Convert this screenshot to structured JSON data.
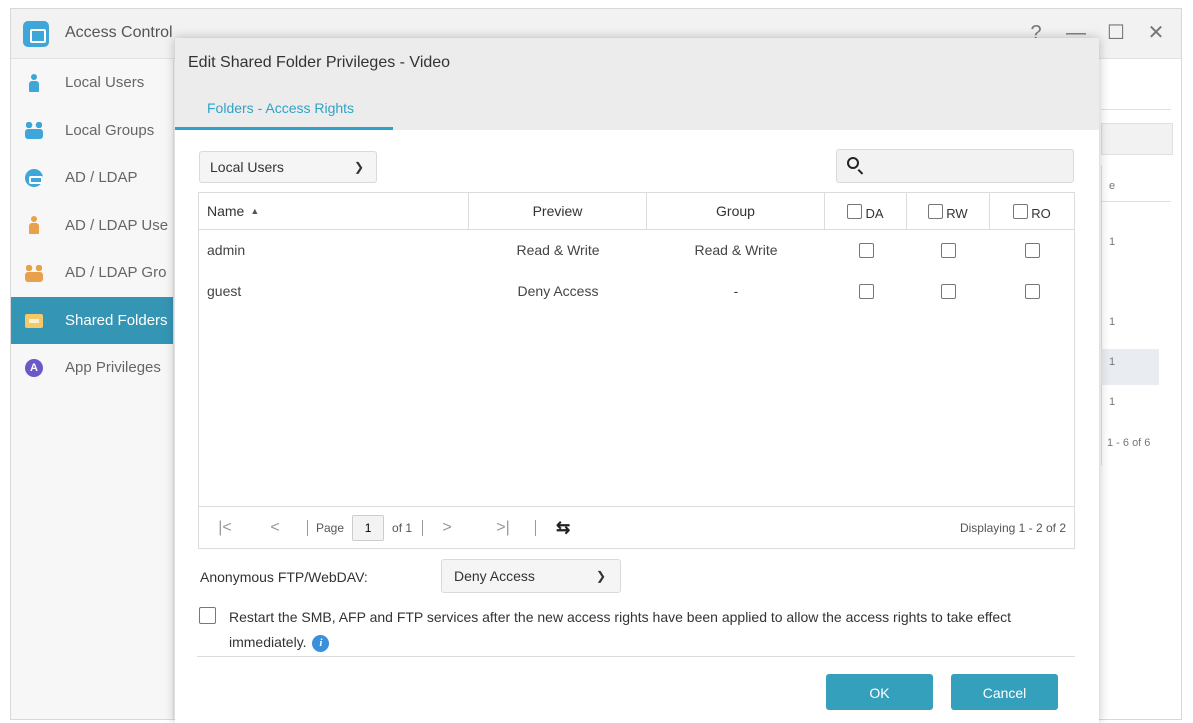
{
  "app": {
    "title": "Access Control",
    "window_controls": [
      "?",
      "—",
      "☐",
      "✕"
    ]
  },
  "sidebar": {
    "items": [
      {
        "label": "Local Users",
        "icon": "user-icon",
        "active": false
      },
      {
        "label": "Local Groups",
        "icon": "group-icon",
        "active": false
      },
      {
        "label": "AD / LDAP",
        "icon": "ad-ldap-icon",
        "active": false
      },
      {
        "label": "AD / LDAP Use",
        "icon": "ad-user-icon",
        "active": false
      },
      {
        "label": "AD / LDAP Gro",
        "icon": "ad-group-icon",
        "active": false
      },
      {
        "label": "Shared Folders",
        "icon": "folder-icon",
        "active": true
      },
      {
        "label": "App Privileges",
        "icon": "app-icon",
        "active": false
      }
    ]
  },
  "background_panel": {
    "header_fragment": "e",
    "row_fragments": [
      "1",
      "1",
      "1",
      "1"
    ],
    "paging_fragment": "1 - 6 of 6"
  },
  "dialog": {
    "title": "Edit Shared Folder Privileges - Video",
    "tab": "Folders - Access Rights",
    "filter_select": "Local Users",
    "search_value": "",
    "columns": {
      "name": "Name",
      "preview": "Preview",
      "group": "Group",
      "da": "DA",
      "rw": "RW",
      "ro": "RO"
    },
    "rows": [
      {
        "name": "admin",
        "preview": "Read & Write",
        "group": "Read & Write",
        "da": false,
        "rw": false,
        "ro": false
      },
      {
        "name": "guest",
        "preview": "Deny Access",
        "group": "-",
        "da": false,
        "rw": false,
        "ro": false
      }
    ],
    "pager": {
      "page_label": "Page",
      "page_value": "1",
      "of_label": "of 1",
      "displaying": "Displaying 1 - 2 of 2"
    },
    "anonymous_label": "Anonymous FTP/WebDAV:",
    "anonymous_value": "Deny Access",
    "restart_text": "Restart the SMB, AFP and FTP services after the new access rights have been applied to allow the access rights to take effect immediately.",
    "ok_label": "OK",
    "cancel_label": "Cancel"
  },
  "colors": {
    "accent": "#2fa3c7",
    "button": "#34a0bc",
    "sidebar_active": "#3595b5"
  }
}
